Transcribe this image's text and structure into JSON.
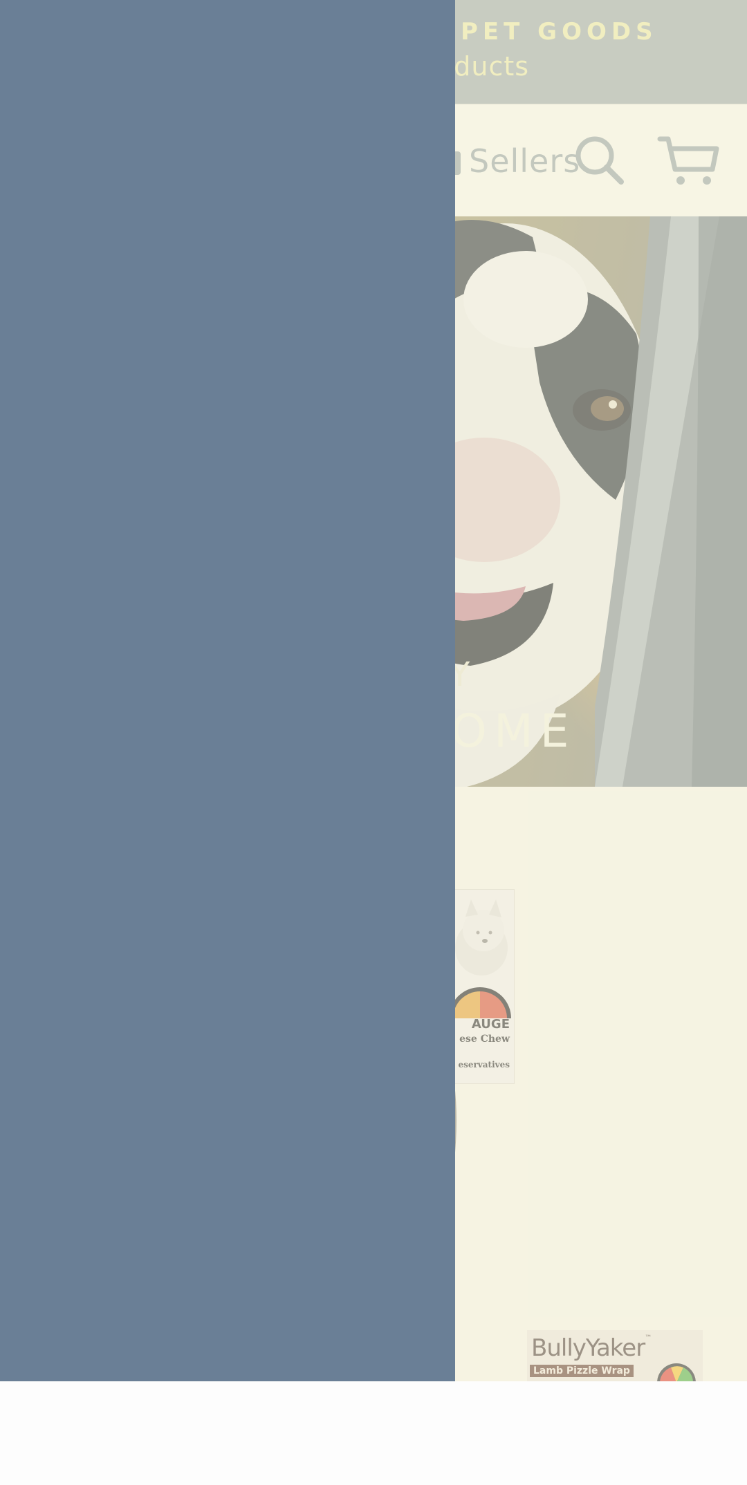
{
  "announcement": {
    "line1": "PET GOODS",
    "line2": "oducts"
  },
  "nav": {
    "sellers_label": "Sellers",
    "icons": [
      "bag-icon",
      "search-icon",
      "cart-icon"
    ]
  },
  "hero": {
    "line1": "Y",
    "line2": "SOME"
  },
  "products": [
    {
      "name": "AUGE",
      "subtitle": "ese Chew",
      "footer": "eservatives"
    },
    {
      "brand": "BullyYaker",
      "tm": "™",
      "subtitle": "Lamb Pizzle Wrap"
    }
  ],
  "drawer": {
    "open": true
  },
  "colors": {
    "drawer": "#6a7f96",
    "announcement_bg": "#a6aea8",
    "announcement_text": "#ece8a6",
    "page_bg": "#f7f5e4",
    "icon": "#9ea7a3"
  }
}
